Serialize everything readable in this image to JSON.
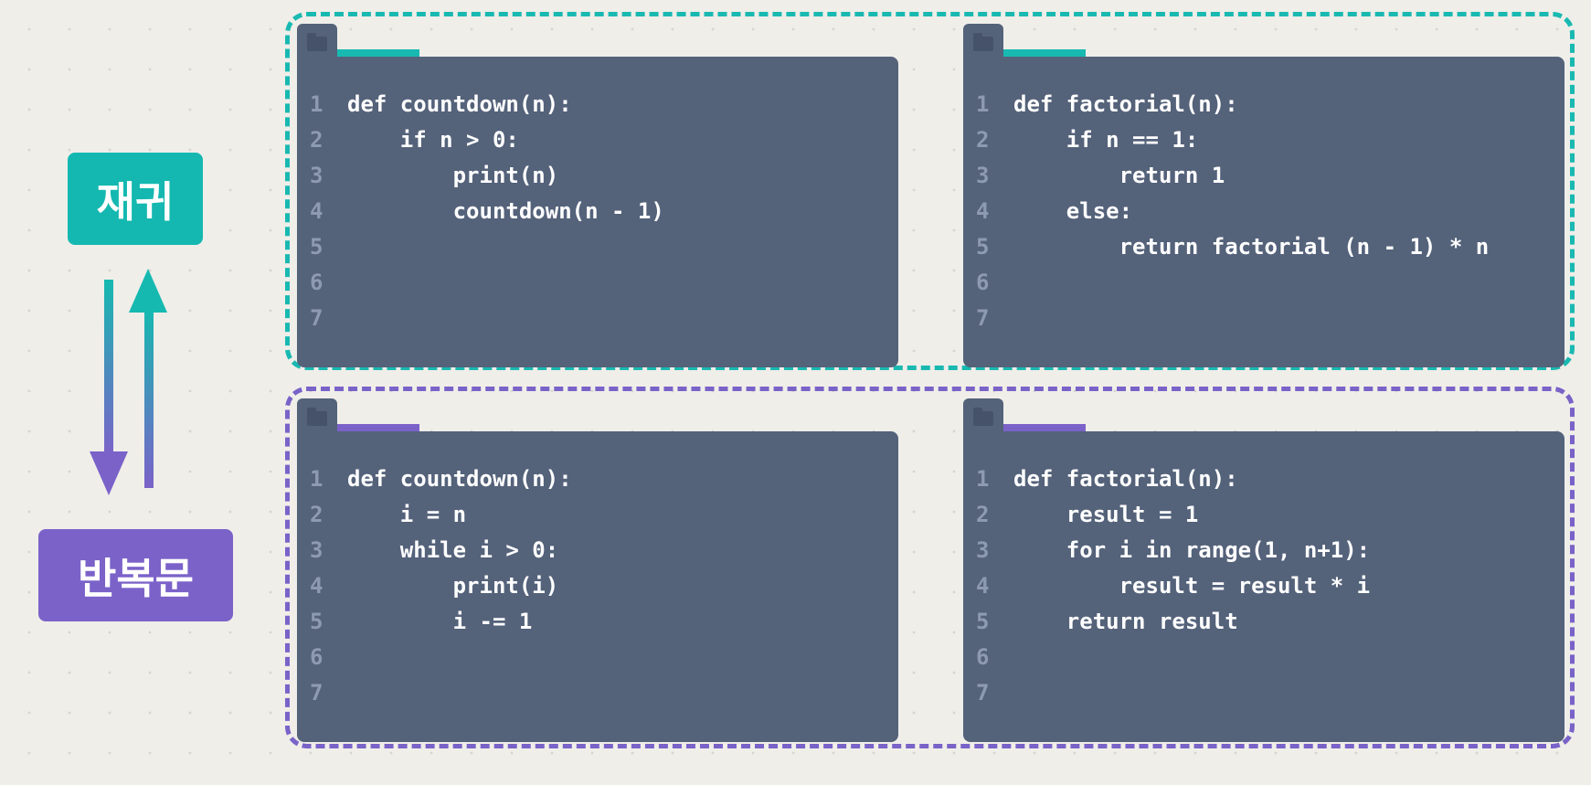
{
  "labels": {
    "recursion": "재귀",
    "iteration": "반복문"
  },
  "colors": {
    "recursion": "#14b8b0",
    "iteration": "#7b62c9",
    "editor_bg": "#54627a",
    "line_number": "#8e9ab0",
    "background": "#efeee9"
  },
  "editors": {
    "rec_countdown": {
      "line_numbers": [
        "1",
        "2",
        "3",
        "4",
        "5",
        "6",
        "7"
      ],
      "lines": [
        "def countdown(n):",
        "    if n > 0:",
        "        print(n)",
        "        countdown(n - 1)",
        "",
        "",
        ""
      ]
    },
    "rec_factorial": {
      "line_numbers": [
        "1",
        "2",
        "3",
        "4",
        "5",
        "6",
        "7"
      ],
      "lines": [
        "def factorial(n):",
        "    if n == 1:",
        "        return 1",
        "    else:",
        "        return factorial (n - 1) * n",
        "",
        ""
      ]
    },
    "iter_countdown": {
      "line_numbers": [
        "1",
        "2",
        "3",
        "4",
        "5",
        "6",
        "7"
      ],
      "lines": [
        "def countdown(n):",
        "    i = n",
        "    while i > 0:",
        "        print(i)",
        "        i -= 1",
        "",
        ""
      ]
    },
    "iter_factorial": {
      "line_numbers": [
        "1",
        "2",
        "3",
        "4",
        "5",
        "6",
        "7"
      ],
      "lines": [
        "def factorial(n):",
        "    result = 1",
        "    for i in range(1, n+1):",
        "        result = result * i",
        "    return result",
        "",
        ""
      ]
    }
  }
}
